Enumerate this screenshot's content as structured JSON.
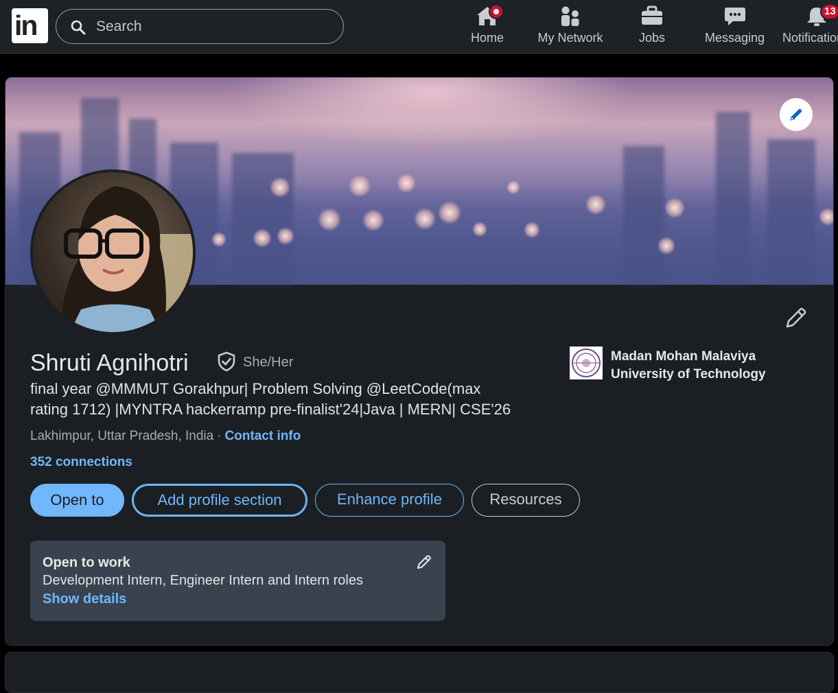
{
  "nav": {
    "search_placeholder": "Search",
    "items": [
      {
        "label": "Home",
        "icon": "home-icon"
      },
      {
        "label": "My Network",
        "icon": "people-icon"
      },
      {
        "label": "Jobs",
        "icon": "briefcase-icon"
      },
      {
        "label": "Messaging",
        "icon": "message-icon"
      },
      {
        "label": "Notifications",
        "icon": "bell-icon"
      }
    ],
    "notifications_count": "13"
  },
  "profile": {
    "name": "Shruti Agnihotri",
    "pronouns": "She/Her",
    "headline_line1": "final year @MMMUT Gorakhpur| Problem Solving @LeetCode(max",
    "headline_line2": "rating 1712) |MYNTRA hackerramp pre-finalist'24|Java | MERN| CSE'26",
    "location": "Lakhimpur, Uttar Pradesh, India",
    "separator": "·",
    "contact_info": "Contact info",
    "connections": "352 connections",
    "school_line1": "Madan Mohan Malaviya",
    "school_line2": "University of Technology"
  },
  "actions": {
    "open_to": "Open to",
    "add_section": "Add profile section",
    "enhance": "Enhance profile",
    "resources": "Resources"
  },
  "open_to_work": {
    "title": "Open to work",
    "roles": "Development Intern, Engineer Intern and Intern roles",
    "show_details": "Show details"
  },
  "colors": {
    "background": "#000000",
    "card": "#1b1f23",
    "accent": "#71b7fb",
    "notification": "#cb112d"
  }
}
